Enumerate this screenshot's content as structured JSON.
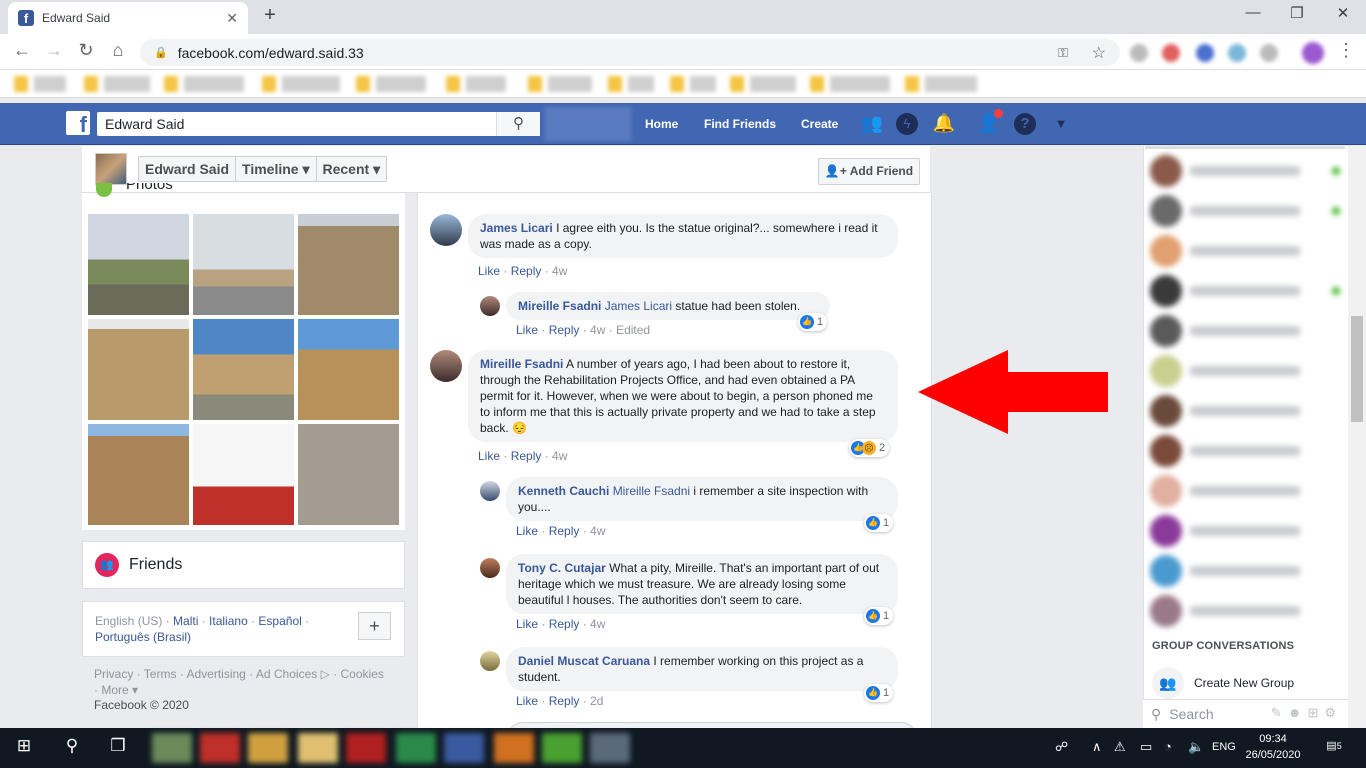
{
  "browser": {
    "tab_title": "Edward Said",
    "url": "facebook.com/edward.said.33",
    "new_tab_symbol": "+",
    "close_symbol": "✕",
    "window_minimize": "—",
    "window_restore": "❐",
    "window_close": "✕"
  },
  "fb_header": {
    "logo": "f",
    "search_value": "Edward Said",
    "nav": [
      "Home",
      "Find Friends",
      "Create"
    ],
    "icons": [
      "friends-icon",
      "messenger-icon",
      "notifications-icon",
      "friend-requests-icon",
      "help-icon",
      "dropdown-icon"
    ]
  },
  "profile": {
    "crumbs": [
      "Edward Said",
      "Timeline ▾",
      "Recent ▾"
    ],
    "add_friend": "Add Friend",
    "photos_heading": "Photos"
  },
  "friends_box": {
    "title": "Friends"
  },
  "languages": {
    "current": "English (US)",
    "others": [
      "Malti",
      "Italiano",
      "Español",
      "Português (Brasil)"
    ],
    "plus": "+"
  },
  "footer": {
    "links": [
      "Privacy",
      "Terms",
      "Advertising",
      "Ad Choices",
      "Cookies",
      "More"
    ],
    "copyright": "Facebook © 2020"
  },
  "comments": [
    {
      "name": "James Licari",
      "mention": "",
      "text": "I agree eith you. Is the statue original?... somewhere i read it was made as a copy.",
      "like": "Like",
      "reply": "Reply",
      "time": "4w",
      "edited": "",
      "reactions": ""
    },
    {
      "name": "Mireille Fsadni",
      "mention": "James Licari",
      "text": "statue had been stolen.",
      "like": "Like",
      "reply": "Reply",
      "time": "4w",
      "edited": "Edited",
      "reactions": "1"
    },
    {
      "name": "Mireille Fsadni",
      "mention": "",
      "text": "A number of years ago, I had been about to restore it, through the Rehabilitation Projects Office, and had even obtained a PA permit for it. However, when we were about to begin, a person phoned me to inform me that this is actually private property and we had to take a step back. 😔",
      "like": "Like",
      "reply": "Reply",
      "time": "4w",
      "edited": "",
      "reactions": "2"
    },
    {
      "name": "Kenneth Cauchi",
      "mention": "Mireille Fsadni",
      "text": "i remember a site inspection with you....",
      "like": "Like",
      "reply": "Reply",
      "time": "4w",
      "edited": "",
      "reactions": "1"
    },
    {
      "name": "Tony C. Cutajar",
      "mention": "",
      "text": "What a pity, Mireille. That's an important part of out heritage which we must treasure. We are already losing some beautiful l houses. The authorities don't seem to care.",
      "like": "Like",
      "reply": "Reply",
      "time": "4w",
      "edited": "",
      "reactions": "1"
    },
    {
      "name": "Daniel Muscat Caruana",
      "mention": "",
      "text": "I remember working on this project as a student.",
      "like": "Like",
      "reply": "Reply",
      "time": "2d",
      "edited": "",
      "reactions": "1"
    }
  ],
  "sidebar": {
    "group_heading": "GROUP CONVERSATIONS",
    "create_group": "Create New Group",
    "search_placeholder": "Search"
  },
  "taskbar": {
    "language": "ENG",
    "time": "09:34",
    "date": "26/05/2020",
    "notification_count": "5"
  },
  "colors": {
    "fb_blue": "#4267b2",
    "link": "#385898",
    "arrow": "#ff0000"
  }
}
